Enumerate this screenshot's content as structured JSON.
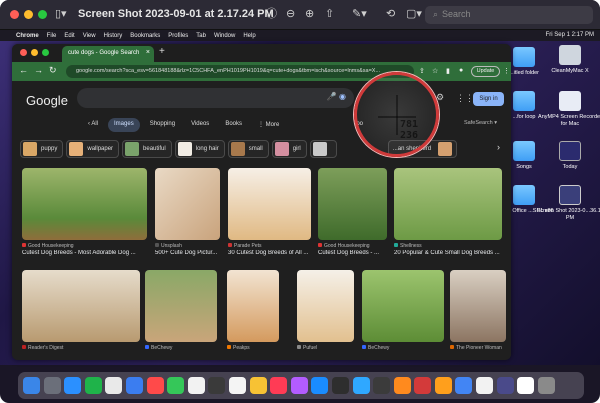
{
  "viewer": {
    "title": "Screen Shot 2023-09-01 at 2.17.24 PM",
    "search_placeholder": "Search",
    "icons": [
      "sidebar-icon",
      "info-icon",
      "zoom-out-icon",
      "zoom-in-icon",
      "share-icon",
      "markup-icon",
      "rotate-icon",
      "crop-icon"
    ]
  },
  "menubar": {
    "items": [
      "Chrome",
      "File",
      "Edit",
      "View",
      "History",
      "Bookmarks",
      "Profiles",
      "Tab",
      "Window",
      "Help"
    ],
    "status": "Fri Sep 1 2:17 PM"
  },
  "desktop": {
    "icons": [
      {
        "label": "...itled folder",
        "kind": "folder"
      },
      {
        "label": "CleanMyMac X",
        "kind": "app"
      },
      {
        "label": "...for loop",
        "kind": "folder"
      },
      {
        "label": "AnyMP4 Screen Recorder for Mac",
        "kind": "app"
      },
      {
        "label": "Songs",
        "kind": "folder"
      },
      {
        "label": "Today",
        "kind": "app"
      },
      {
        "label": "...osoft Office ...SP1 x86",
        "kind": "folder"
      },
      {
        "label": "Screen Shot 2023-0...36.11 PM",
        "kind": "app"
      }
    ]
  },
  "chrome": {
    "tab_title": "cute dogs - Google Search",
    "url": "google.com/search?sca_esv=561848188&rlz=1C5CHFA_enPH1019PH1019&q=cute+dogs&tbm=isch&source=lnms&sa=X...",
    "update_label": "Update"
  },
  "google": {
    "logo": "Google",
    "sign_in": "Sign in",
    "safesearch": "SafeSearch ▾",
    "tabs": [
      "All",
      "Images",
      "Shopping",
      "Videos",
      "Books",
      "More",
      "Too"
    ],
    "active_tab": "Images",
    "chips": [
      "puppy",
      "wallpaper",
      "beautiful",
      "long hair",
      "small",
      "girl",
      "",
      "...an shepherd"
    ],
    "results": [
      {
        "source": "Good Housekeeping",
        "title": "Cutest Dog Breeds - Most Adorable Dog ..."
      },
      {
        "source": "Unsplash",
        "title": "500+ Cute Dog Pictur..."
      },
      {
        "source": "Parade Pets",
        "title": "30 Cutest Dog Breeds of All ..."
      },
      {
        "source": "Good Housekeeping",
        "title": "Cutest Dog Breeds - ..."
      },
      {
        "source": "Shellness",
        "title": "20 Popular & Cute Small Dog Breeds ..."
      },
      {
        "source": "Reader's Digest",
        "title": ""
      },
      {
        "source": "BeChewy",
        "title": ""
      },
      {
        "source": "Peakps",
        "title": ""
      },
      {
        "source": "Pufuel",
        "title": ""
      },
      {
        "source": "BeChewy",
        "title": ""
      },
      {
        "source": "The Pioneer Woman",
        "title": ""
      }
    ]
  },
  "magnifier": {
    "coords": "781\n236"
  },
  "dock": {
    "colors": [
      "#3a86e8",
      "#6b6f7a",
      "#2b90ff",
      "#1fb34a",
      "#e9e9e9",
      "#3b7df0",
      "#ff4a4a",
      "#35c759",
      "#f2f2f2",
      "#3a3a3a",
      "#f4f4f4",
      "#f7c234",
      "#ff3b55",
      "#b35cff",
      "#1a8cff",
      "#2e2e2e",
      "#2fa8ff",
      "#3b3b3b",
      "#ff8a1e",
      "#d33a3a",
      "#ff9f1c",
      "#4285f4",
      "#f2f2f2",
      "#4a4a8a",
      "#ffffff",
      "#8a8a8a"
    ]
  },
  "colors": {
    "chrome_green": "#2f6e3a",
    "accent_red": "#d03a3a",
    "signin_blue": "#8ab4f8"
  }
}
